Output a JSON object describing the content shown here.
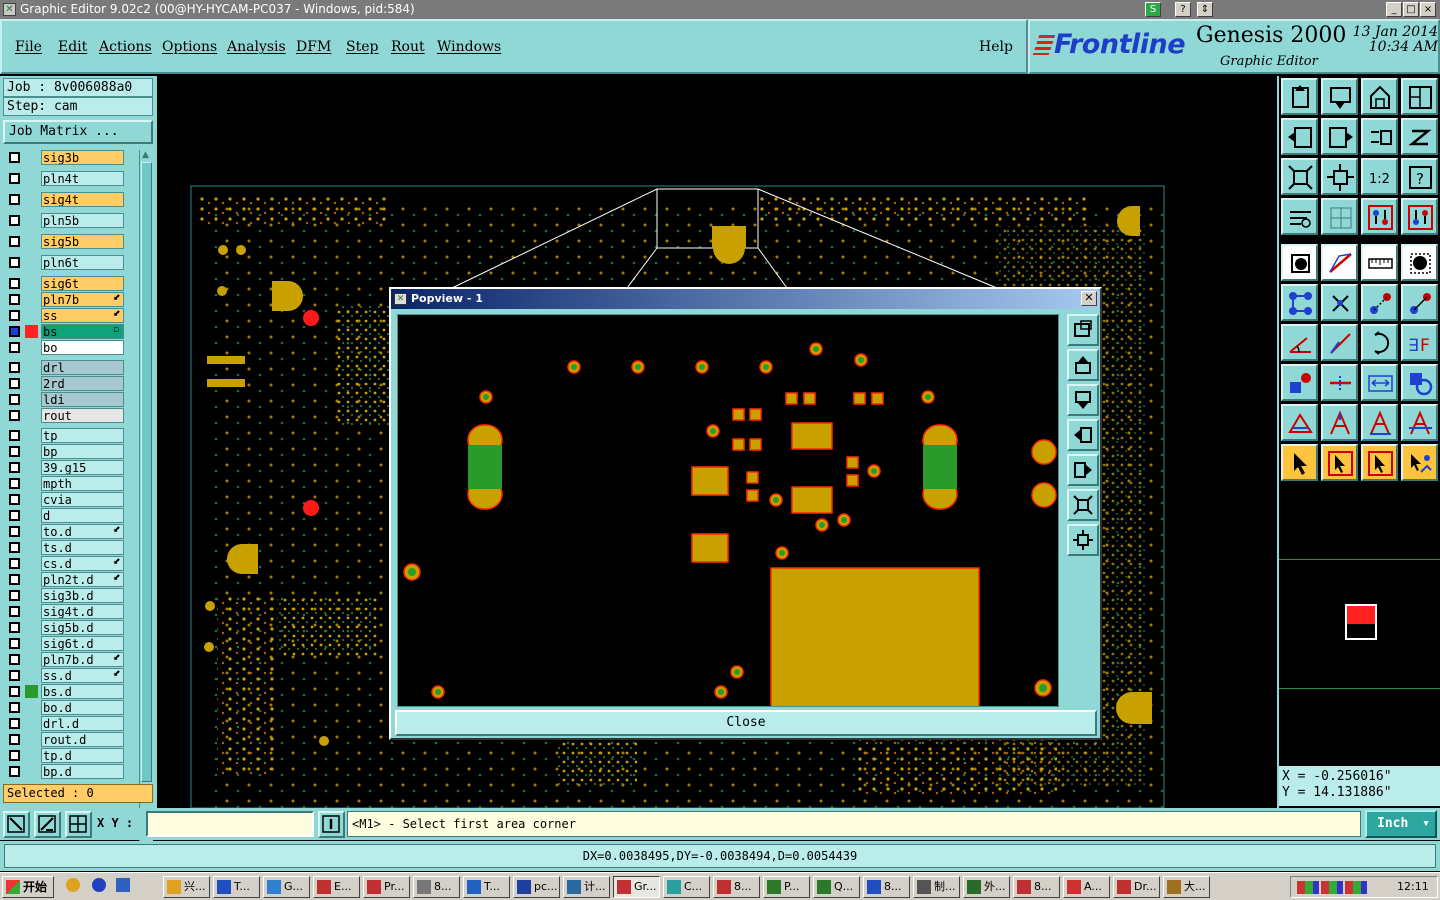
{
  "window": {
    "title": "Graphic Editor 9.02c2 (00@HY-HYCAM-PC037 - Windows, pid:584)",
    "controls": [
      "_",
      "□",
      "×"
    ]
  },
  "menu": {
    "items": [
      "File",
      "Edit",
      "Actions",
      "Options",
      "Analysis",
      "DFM",
      "Step",
      "Rout",
      "Windows"
    ],
    "help": "Help"
  },
  "brand": {
    "logo": "Frontline",
    "product": "Genesis 2000",
    "subtitle": "Graphic Editor",
    "date": "13 Jan 2014",
    "time": "10:34 AM"
  },
  "job": {
    "job_label": "Job : 8v006088a0",
    "step_label": "Step: cam",
    "matrix_button": "Job Matrix ..."
  },
  "layers": [
    {
      "name": "sig3b",
      "color": "#ffcc66",
      "mark": ""
    },
    {
      "name": "pln4t",
      "color": "#b9ecea",
      "mark": ""
    },
    {
      "name": "sig4t",
      "color": "#ffcc66",
      "mark": ""
    },
    {
      "name": "pln5b",
      "color": "#b9ecea",
      "mark": ""
    },
    {
      "name": "sig5b",
      "color": "#ffcc66",
      "mark": ""
    },
    {
      "name": "pln6t",
      "color": "#b9ecea",
      "mark": ""
    },
    {
      "name": "sig6t",
      "color": "#ffcc66",
      "mark": ""
    },
    {
      "name": "pln7b",
      "color": "#ffcc66",
      "mark": "⬋"
    },
    {
      "name": "ss",
      "color": "#ffcc66",
      "mark": "⬋"
    },
    {
      "name": "bs",
      "color": "#0ea37a",
      "mark": "▫",
      "swatch": "#ff2222",
      "active": true
    },
    {
      "name": "bo",
      "color": "#ffffff",
      "mark": ""
    },
    {
      "name": "drl",
      "color": "#a8c8d0",
      "mark": ""
    },
    {
      "name": "2rd",
      "color": "#a8c8d0",
      "mark": ""
    },
    {
      "name": "ldi",
      "color": "#a8c8d0",
      "mark": ""
    },
    {
      "name": "rout",
      "color": "#e6e6e6",
      "mark": ""
    },
    {
      "name": "tp",
      "color": "#b9ecea",
      "mark": ""
    },
    {
      "name": "bp",
      "color": "#b9ecea",
      "mark": ""
    },
    {
      "name": "39.g15",
      "color": "#b9ecea",
      "mark": ""
    },
    {
      "name": "mpth",
      "color": "#b9ecea",
      "mark": ""
    },
    {
      "name": "cvia",
      "color": "#b9ecea",
      "mark": ""
    },
    {
      "name": "d",
      "color": "#b9ecea",
      "mark": ""
    },
    {
      "name": "to.d",
      "color": "#b9ecea",
      "mark": "⬋"
    },
    {
      "name": "ts.d",
      "color": "#b9ecea",
      "mark": ""
    },
    {
      "name": "cs.d",
      "color": "#b9ecea",
      "mark": "⬋"
    },
    {
      "name": "pln2t.d",
      "color": "#b9ecea",
      "mark": "⬋"
    },
    {
      "name": "sig3b.d",
      "color": "#b9ecea",
      "mark": ""
    },
    {
      "name": "sig4t.d",
      "color": "#b9ecea",
      "mark": ""
    },
    {
      "name": "sig5b.d",
      "color": "#b9ecea",
      "mark": ""
    },
    {
      "name": "sig6t.d",
      "color": "#b9ecea",
      "mark": ""
    },
    {
      "name": "pln7b.d",
      "color": "#b9ecea",
      "mark": "⬋"
    },
    {
      "name": "ss.d",
      "color": "#b9ecea",
      "mark": "⬋"
    },
    {
      "name": "bs.d",
      "color": "#b9ecea",
      "mark": "",
      "swatch": "#2a9a2a"
    },
    {
      "name": "bo.d",
      "color": "#b9ecea",
      "mark": ""
    },
    {
      "name": "drl.d",
      "color": "#b9ecea",
      "mark": ""
    },
    {
      "name": "rout.d",
      "color": "#b9ecea",
      "mark": ""
    },
    {
      "name": "tp.d",
      "color": "#b9ecea",
      "mark": ""
    },
    {
      "name": "bp.d",
      "color": "#b9ecea",
      "mark": ""
    }
  ],
  "selected_label": "Selected : 0",
  "popview": {
    "title": "Popview - 1",
    "close_button": "Close"
  },
  "coords": {
    "x": "X = -0.256016\"",
    "y": "Y = 14.131886\""
  },
  "command": {
    "xy_label": "X Y :",
    "xy_value": "",
    "prompt": "<M1> - Select first area corner",
    "unit": "Inch"
  },
  "status": "DX=0.0038495,DY=-0.0038494,D=0.0054439",
  "taskbar": {
    "start": "开始",
    "tasks": [
      "兴...",
      "T...",
      "G...",
      "E...",
      "Pr...",
      "8...",
      "T...",
      "pc...",
      "计...",
      "Gr...",
      "C...",
      "8...",
      "P...",
      "Q...",
      "8...",
      "制...",
      "外...",
      "8...",
      "A...",
      "Dr...",
      "大..."
    ],
    "clock": "12:11"
  },
  "colors": {
    "panel": "#8fd8d6",
    "pad": "#c8a000",
    "pad_outline": "#ff2a00",
    "drill": "#2a9a2a",
    "highlight": "#ffcc66"
  }
}
